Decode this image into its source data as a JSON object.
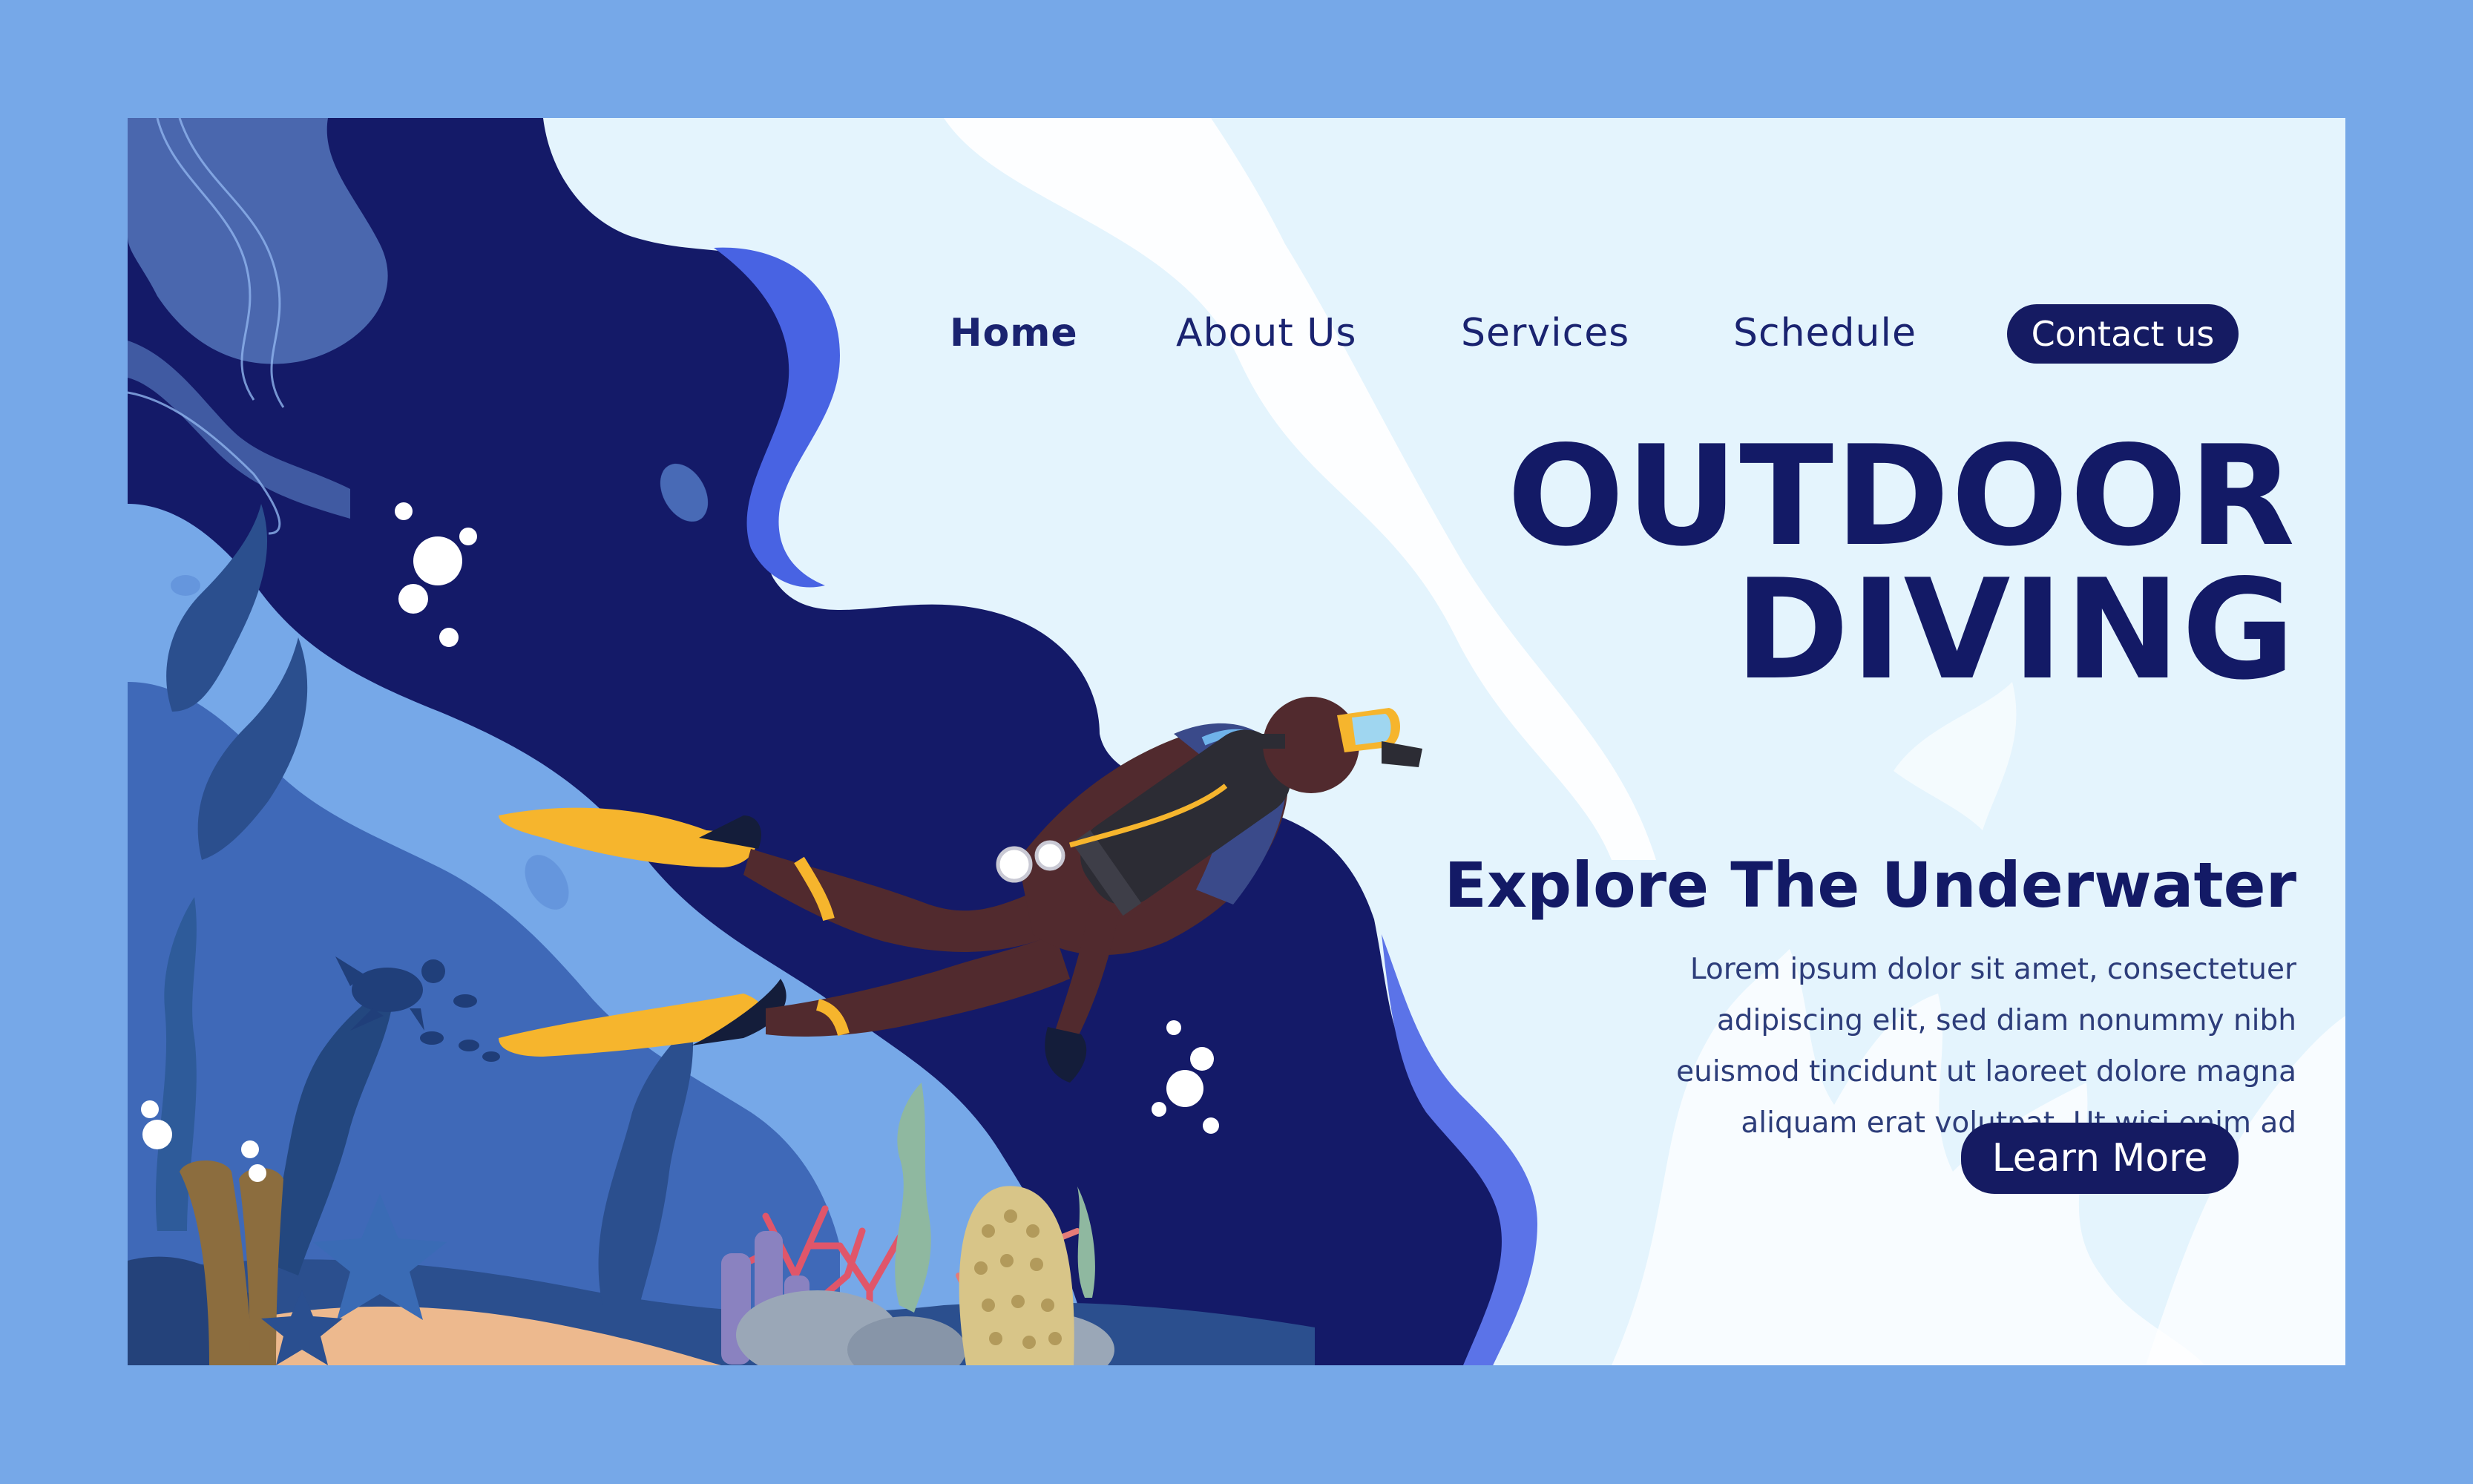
{
  "nav": {
    "items": [
      {
        "label": "Home",
        "active": true
      },
      {
        "label": "About Us",
        "active": false
      },
      {
        "label": "Services",
        "active": false
      },
      {
        "label": "Schedule",
        "active": false
      }
    ],
    "contact_label": "Contact us"
  },
  "hero": {
    "title_line1": "OUTDOOR",
    "title_line2": "DIVING",
    "subtitle": "Explore The Underwater",
    "paragraph_lines": [
      "Lorem ipsum dolor sit amet, consectetuer",
      "adipiscing elit, sed diam nonummy nibh",
      "euismod tincidunt ut laoreet dolore magna",
      "aliquam erat volutpat. Ut wisi enim ad"
    ],
    "cta_label": "Learn More"
  },
  "colors": {
    "page_background": "#76a8e8",
    "card_background": "#e4f4fd",
    "navy": "#131a66",
    "deep_water": "#141a68",
    "mid_water": "#76a8e8"
  },
  "illustration": {
    "subject": "scuba-diver",
    "elements": [
      "diver",
      "air-tank",
      "fins",
      "bubbles",
      "coral",
      "sea-turtle",
      "fish",
      "starfish",
      "seaweed",
      "rocks"
    ]
  }
}
